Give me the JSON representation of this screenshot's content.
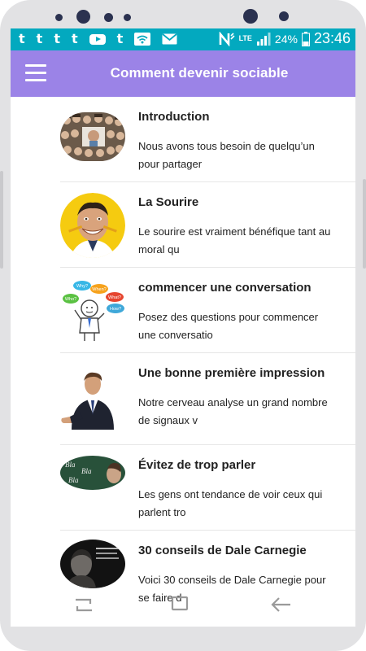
{
  "status_bar": {
    "notifications": [
      "t",
      "t",
      "t",
      "t",
      "youtube",
      "t",
      "wifi",
      "mail"
    ],
    "network": "LTE",
    "battery": "24%",
    "time": "23:46"
  },
  "app_bar": {
    "title": "Comment devenir sociable",
    "menu_icon": "hamburger-menu-icon",
    "background": "#9b83e7"
  },
  "articles": [
    {
      "title": "Introduction",
      "desc_line1": "Nous avons tous besoin de quelqu’un",
      "desc_line2": "pour partager",
      "image": "crowd-faces-image"
    },
    {
      "title": "La Sourire",
      "desc_line1": "Le sourire est vraiment bénéfique tant au",
      "desc_line2": "moral qu",
      "image": "smiling-man-image"
    },
    {
      "title": "commencer une conversation",
      "desc_line1": "Posez des questions pour commencer",
      "desc_line2": "une conversatio",
      "image": "speech-bubbles-image",
      "bubbles": [
        "Why?",
        "When?",
        "Who?",
        "What?",
        "How?"
      ]
    },
    {
      "title": "Une bonne première impression",
      "desc_line1": "Notre cerveau analyse un grand nombre",
      "desc_line2": "de signaux v",
      "image": "handshake-man-image"
    },
    {
      "title": "Évitez de trop parler",
      "desc_line1": "Les gens ont tendance de voir ceux qui",
      "desc_line2": "parlent tro",
      "image": "bla-bla-chalkboard-image",
      "bla": [
        "Bla",
        "Bla",
        "Bla"
      ]
    },
    {
      "title": "30 conseils de Dale Carnegie",
      "desc_line1": "Voici 30 conseils de Dale Carnegie pour",
      "desc_line2": "se faire d",
      "image": "dale-carnegie-portrait-image"
    }
  ],
  "nav": {
    "recent_icon": "recent-apps-icon",
    "home_icon": "home-icon",
    "back_icon": "back-arrow-icon"
  }
}
